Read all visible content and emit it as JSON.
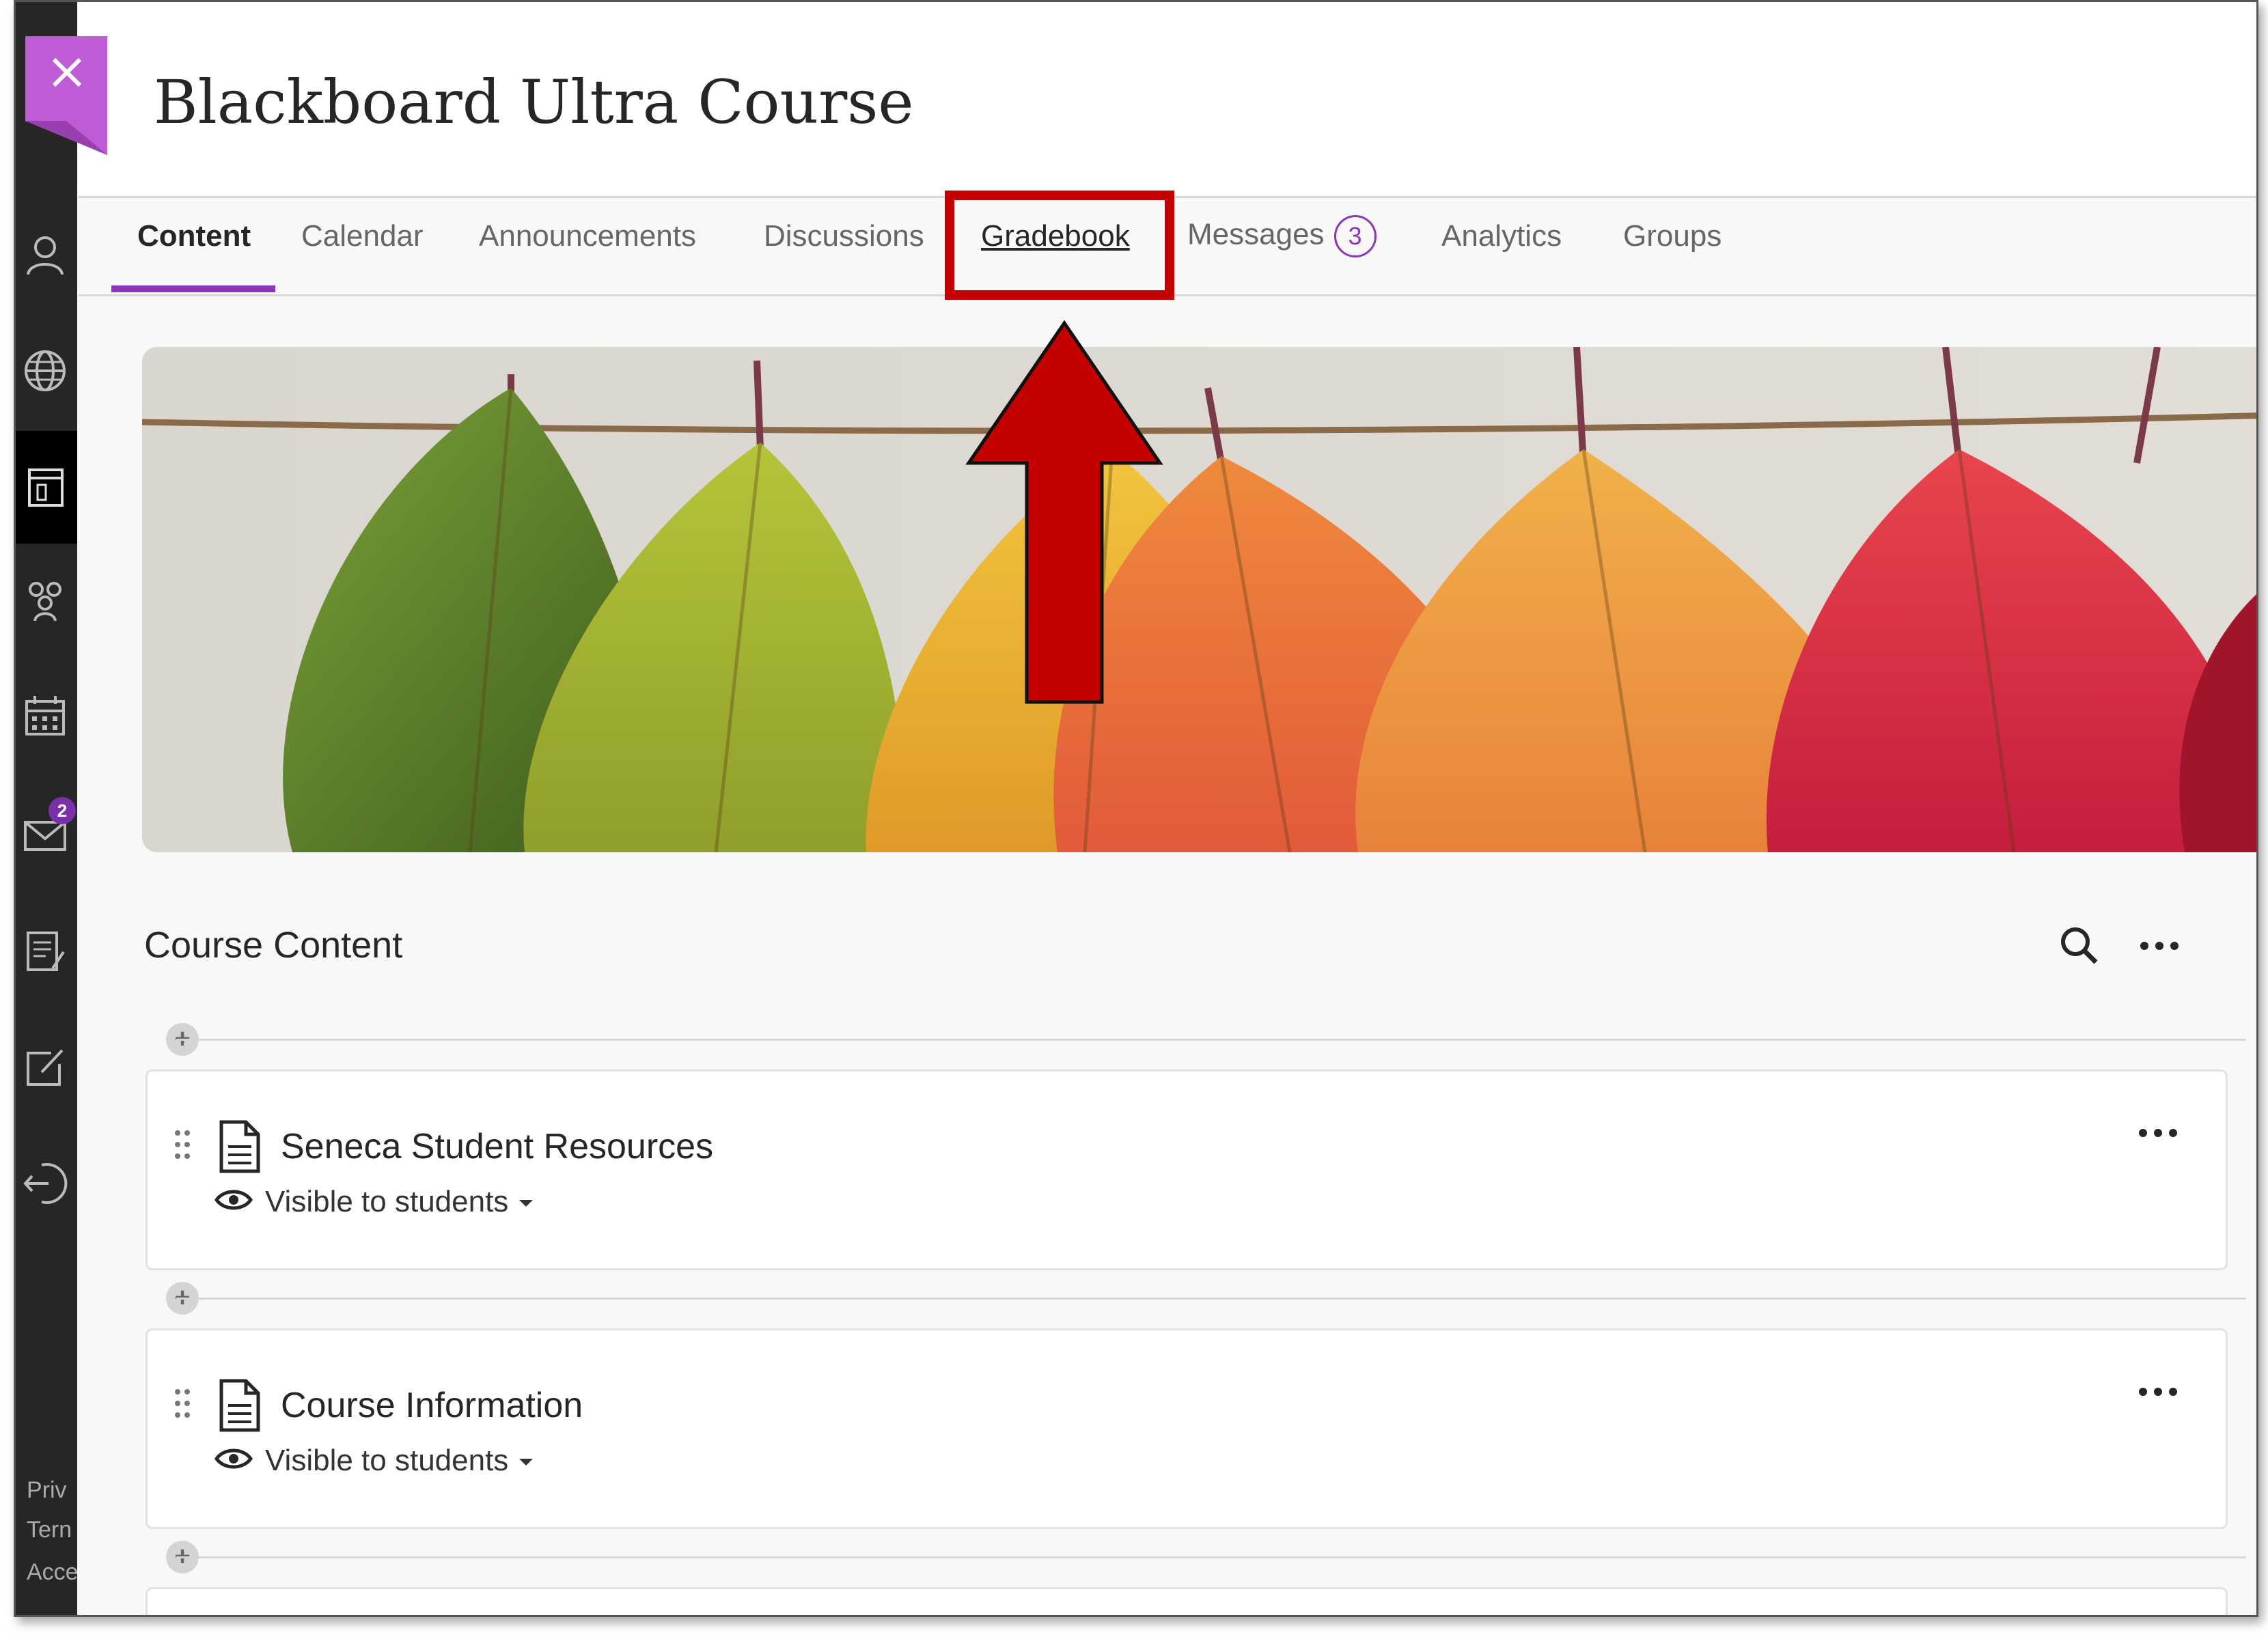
{
  "course": {
    "title": "Blackboard Ultra Course"
  },
  "tabs": [
    {
      "label": "Content",
      "active": true
    },
    {
      "label": "Calendar"
    },
    {
      "label": "Announcements"
    },
    {
      "label": "Discussions"
    },
    {
      "label": "Gradebook",
      "highlighted": true
    },
    {
      "label": "Messages",
      "badge": "3"
    },
    {
      "label": "Analytics"
    },
    {
      "label": "Groups"
    }
  ],
  "rail": {
    "messages_badge": "2",
    "footer": [
      "Priv",
      "Tern",
      "Acce"
    ]
  },
  "content": {
    "section_title": "Course Content",
    "items": [
      {
        "title": "Seneca Student Resources",
        "visibility": "Visible to students"
      },
      {
        "title": "Course Information",
        "visibility": "Visible to students"
      }
    ]
  },
  "colors": {
    "accent": "#8e35ba",
    "close_tag": "#c05bd8",
    "annotation_red": "#c40000",
    "rail": "#262626"
  }
}
